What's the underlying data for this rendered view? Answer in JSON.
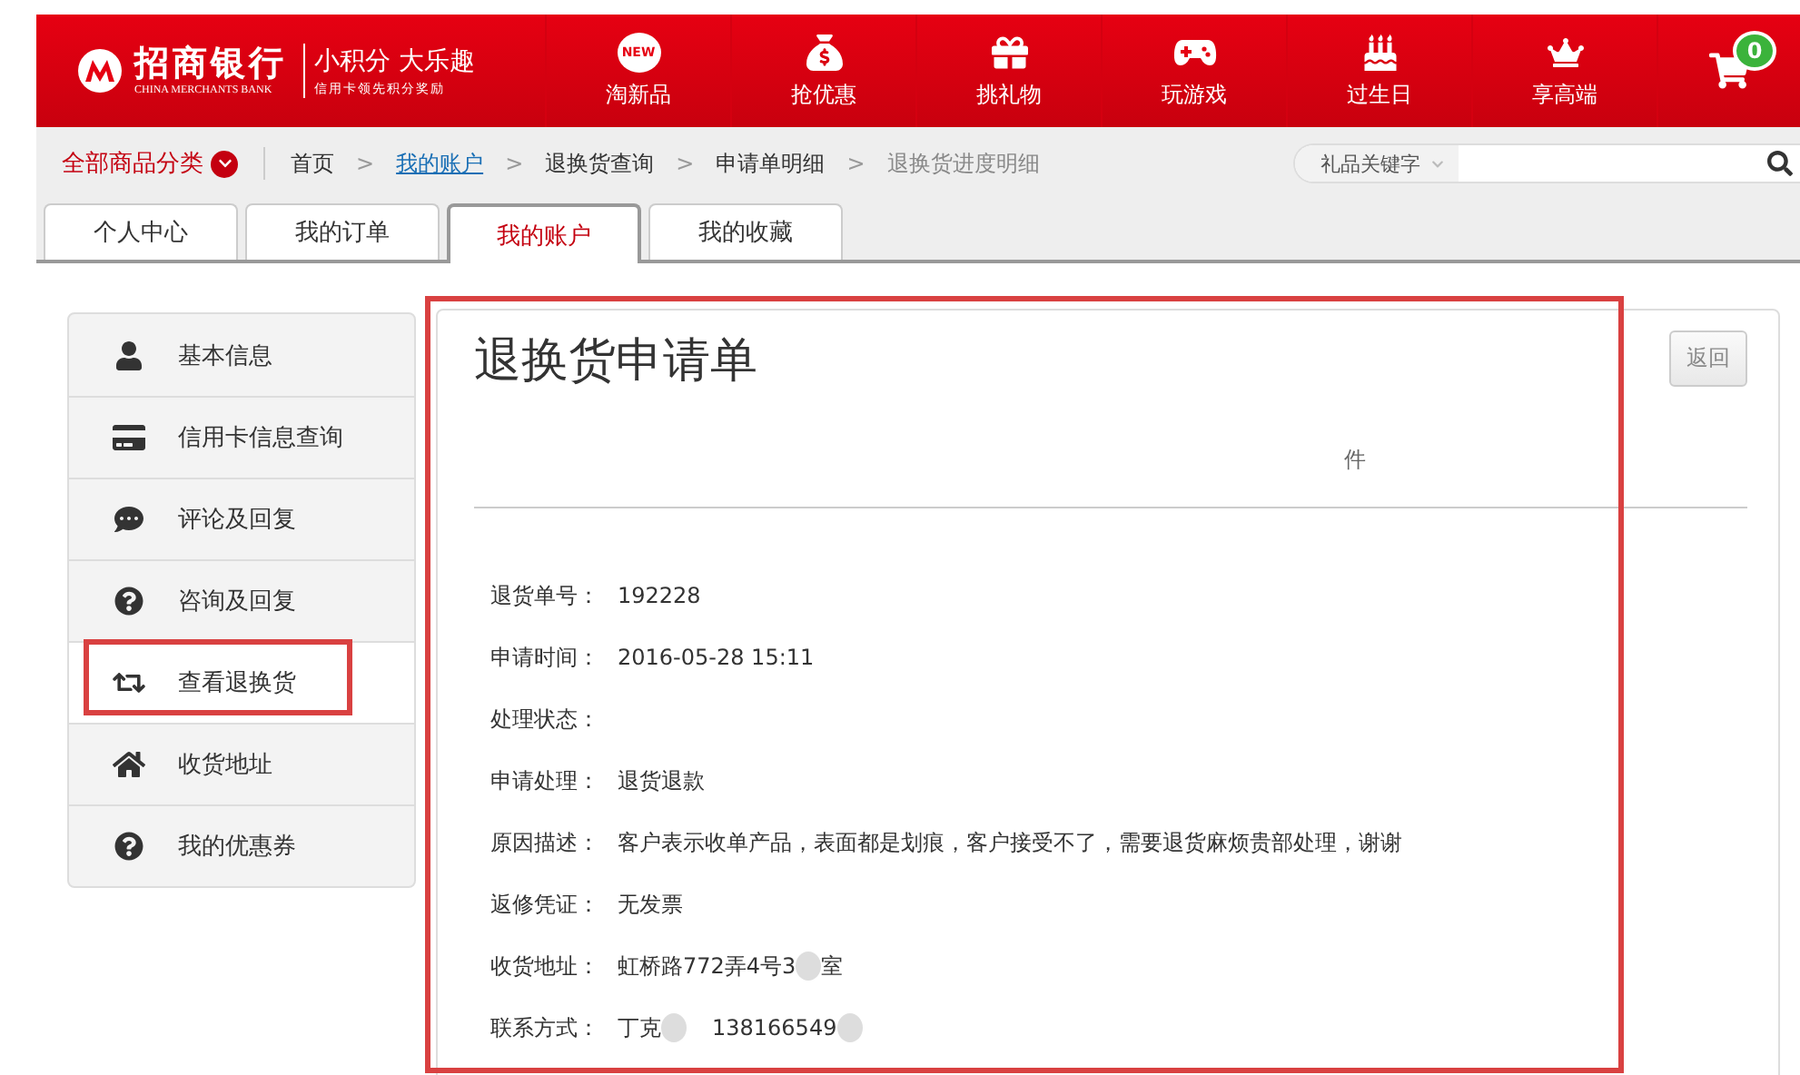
{
  "header": {
    "logo": {
      "name": "招商银行",
      "english": "CHINA MERCHANTS BANK",
      "slogan": "小积分 大乐趣",
      "subslogan": "信用卡领先积分奖励"
    },
    "nav": [
      {
        "kind": "new",
        "label": "淘新品",
        "badge": "NEW"
      },
      {
        "kind": "money",
        "label": "抢优惠"
      },
      {
        "kind": "gift",
        "label": "挑礼物"
      },
      {
        "kind": "game",
        "label": "玩游戏"
      },
      {
        "kind": "cake",
        "label": "过生日"
      },
      {
        "kind": "crown",
        "label": "享高端"
      }
    ],
    "cart": {
      "count": "0"
    }
  },
  "subbar": {
    "category": "全部商品分类",
    "breadcrumbs": [
      {
        "label": "首页",
        "link": false,
        "current": false
      },
      {
        "label": "我的账户",
        "link": true,
        "current": false
      },
      {
        "label": "退换货查询",
        "link": false,
        "current": false
      },
      {
        "label": "申请单明细",
        "link": false,
        "current": false
      },
      {
        "label": "退换货进度明细",
        "current": true,
        "link": false
      }
    ],
    "separator": ">",
    "search": {
      "scope": "礼品关键字"
    }
  },
  "tabs": [
    {
      "label": "个人中心",
      "selected": false
    },
    {
      "label": "我的订单",
      "selected": false
    },
    {
      "label": "我的账户",
      "selected": true
    },
    {
      "label": "我的收藏",
      "selected": false
    }
  ],
  "sidebar": {
    "items": [
      {
        "kind": "user",
        "label": "基本信息",
        "selected": false,
        "highlight": false
      },
      {
        "kind": "card",
        "label": "信用卡信息查询",
        "selected": false,
        "highlight": false
      },
      {
        "kind": "comment",
        "label": "评论及回复",
        "selected": false,
        "highlight": false
      },
      {
        "kind": "question",
        "label": "咨询及回复",
        "selected": false,
        "highlight": false
      },
      {
        "kind": "exchange",
        "label": "查看退换货",
        "selected": true,
        "highlight": true
      },
      {
        "kind": "home",
        "label": "收货地址",
        "selected": false,
        "highlight": false
      },
      {
        "kind": "question",
        "label": "我的优惠券",
        "selected": false,
        "highlight": false
      }
    ]
  },
  "panel": {
    "title": "退换货申请单",
    "back_button": "返回",
    "column_label": "件",
    "highlight": true,
    "fields": [
      {
        "label": "退货单号：",
        "value": [
          {
            "kind": "text",
            "text": "192228"
          }
        ]
      },
      {
        "label": "申请时间：",
        "value": [
          {
            "kind": "text",
            "text": "2016-05-28 15:11"
          }
        ]
      },
      {
        "label": "处理状态："
      },
      {
        "label": "申请处理：",
        "value": [
          {
            "kind": "text",
            "text": "退货退款"
          }
        ]
      },
      {
        "label": "原因描述：",
        "value": [
          {
            "kind": "text",
            "text": "客户表示收单产品，表面都是划痕，客户接受不了，需要退货麻烦贵部处理，谢谢"
          }
        ]
      },
      {
        "label": "返修凭证：",
        "value": [
          {
            "kind": "text",
            "text": "无发票"
          }
        ]
      },
      {
        "label": "收货地址：",
        "value": [
          {
            "kind": "text",
            "text": "虹桥路772弄4号3"
          },
          {
            "kind": "redacted"
          },
          {
            "kind": "text",
            "text": "室"
          }
        ]
      },
      {
        "label": "联系方式：",
        "value": [
          {
            "kind": "text",
            "text": "丁克"
          },
          {
            "kind": "redacted"
          },
          {
            "kind": "gap"
          },
          {
            "kind": "text",
            "text": "138166549"
          },
          {
            "kind": "redacted"
          }
        ]
      }
    ]
  }
}
